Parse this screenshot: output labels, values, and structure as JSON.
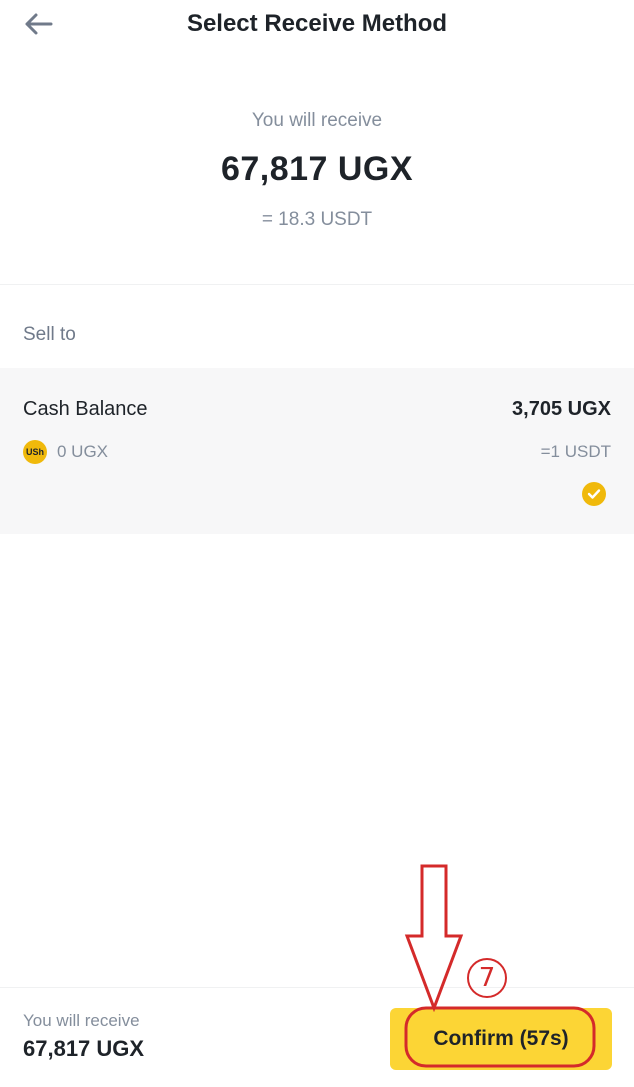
{
  "header": {
    "title": "Select Receive Method",
    "back_icon": "arrow-left-icon"
  },
  "summary": {
    "label": "You will receive",
    "amount": "67,817 UGX",
    "usdt_equivalent": "= 18.3 USDT"
  },
  "section": {
    "label": "Sell to"
  },
  "method": {
    "name": "Cash Balance",
    "balance_icon_text": "USh",
    "balance": "0 UGX",
    "rate": "3,705 UGX",
    "rate_usdt": "=1 USDT",
    "selected": true
  },
  "footer": {
    "label": "You will receive",
    "amount": "67,817 UGX",
    "confirm_label": "Confirm (57s)"
  },
  "annotation": {
    "step_number": "7",
    "color": "#d42a2a"
  },
  "colors": {
    "accent": "#fcd535",
    "brand_yellow": "#f0b90b",
    "text_primary": "#1e2329",
    "text_secondary": "#848e9c"
  }
}
